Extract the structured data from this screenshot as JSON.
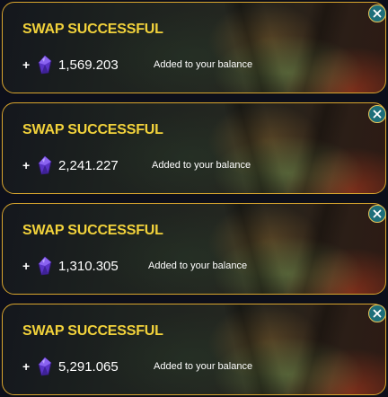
{
  "notifications": [
    {
      "title": "SWAP SUCCESSFUL",
      "plus": "+",
      "amount": "1,569.203",
      "message": "Added to your balance"
    },
    {
      "title": "SWAP SUCCESSFUL",
      "plus": "+",
      "amount": "2,241.227",
      "message": "Added to your balance"
    },
    {
      "title": "SWAP SUCCESSFUL",
      "plus": "+",
      "amount": "1,310.305",
      "message": "Added to your balance"
    },
    {
      "title": "SWAP SUCCESSFUL",
      "plus": "+",
      "amount": "5,291.065",
      "message": "Added to your balance"
    }
  ],
  "icons": {
    "currency": "purple-gem-icon",
    "close": "close-icon"
  },
  "colors": {
    "title": "#f2d23b",
    "border": "#d8a52e",
    "close_bg": "#1e6f7a",
    "gem": "#6a3fd6"
  }
}
